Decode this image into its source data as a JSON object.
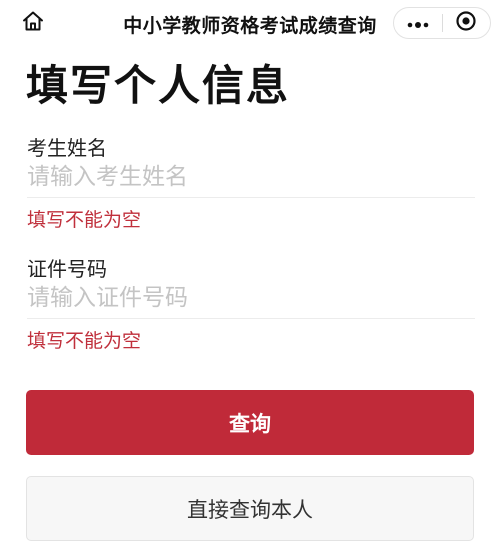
{
  "navbar": {
    "title": "中小学教师资格考试成绩查询",
    "home_icon": "home-icon",
    "more_icon": "more-dots-icon",
    "close_icon": "target-close-icon"
  },
  "page": {
    "title": "填写个人信息"
  },
  "form": {
    "name": {
      "label": "考生姓名",
      "placeholder": "请输入考生姓名",
      "value": "",
      "error": "填写不能为空"
    },
    "id_number": {
      "label": "证件号码",
      "placeholder": "请输入证件号码",
      "value": "",
      "error": "填写不能为空"
    }
  },
  "buttons": {
    "query_label": "查询",
    "query_self_label": "直接查询本人"
  },
  "colors": {
    "primary": "#c02a39",
    "error": "#c0303c",
    "placeholder": "#c4c4c4"
  }
}
